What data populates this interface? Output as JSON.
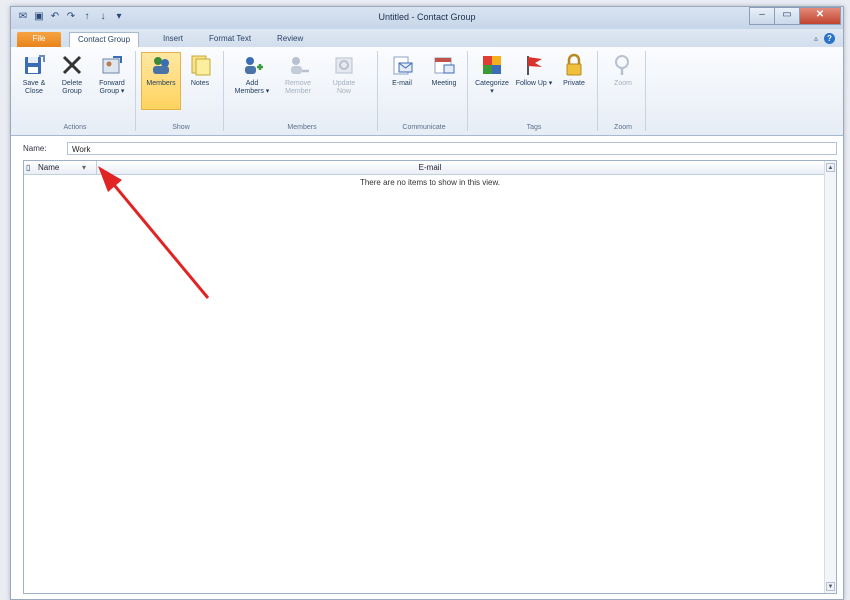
{
  "window": {
    "title": "Untitled - Contact Group"
  },
  "qat": {
    "icons": [
      "outlook-icon",
      "save-icon",
      "undo-icon",
      "redo-icon",
      "up-arrow-icon",
      "down-arrow-icon",
      "customize-icon"
    ]
  },
  "tabs": [
    {
      "label": "File"
    },
    {
      "label": "Contact Group"
    },
    {
      "label": "Insert"
    },
    {
      "label": "Format Text"
    },
    {
      "label": "Review"
    }
  ],
  "ribbon": {
    "groups": {
      "actions": "Actions",
      "show": "Show",
      "members": "Members",
      "communicate": "Communicate",
      "tags": "Tags",
      "zoom": "Zoom"
    },
    "buttons": {
      "save_close": "Save & Close",
      "delete_group": "Delete Group",
      "forward_group": "Forward Group ▾",
      "members": "Members",
      "notes": "Notes",
      "add_members": "Add Members ▾",
      "remove_member": "Remove Member",
      "update_now": "Update Now",
      "email": "E-mail",
      "meeting": "Meeting",
      "categorize": "Categorize ▾",
      "follow_up": "Follow Up ▾",
      "private": "Private",
      "zoom": "Zoom"
    }
  },
  "name_field": {
    "label": "Name:",
    "value": "Work"
  },
  "list": {
    "col_name": "Name",
    "col_email": "E-mail",
    "empty_message": "There are no items to show in this view."
  },
  "colors": {
    "file_tab": "#e8841b",
    "selected_button": "#ffd35e",
    "annotation_arrow": "#e02424"
  }
}
